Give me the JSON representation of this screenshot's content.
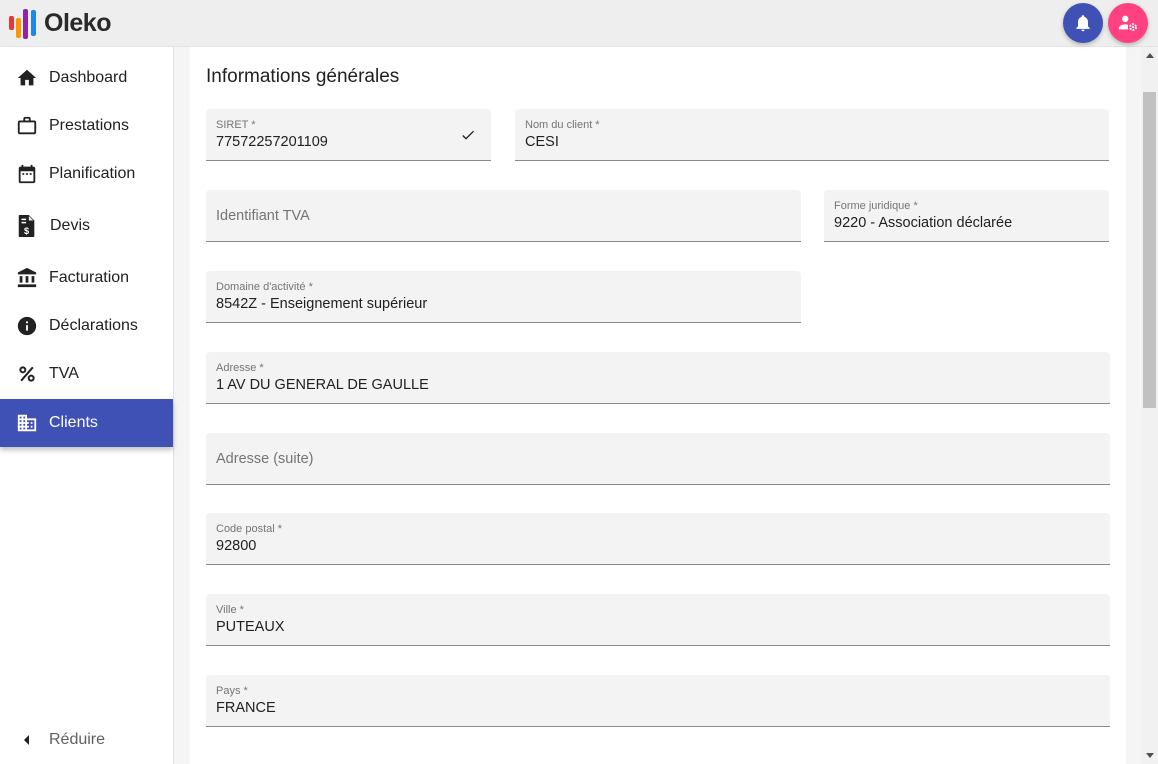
{
  "app": {
    "name": "Oleko",
    "logo_colors": [
      "#e53935",
      "#ff9800",
      "#8e24aa",
      "#1e88e5"
    ]
  },
  "header": {
    "notifications_icon": "bell-icon",
    "account_icon": "user-settings-icon",
    "notifications_color": "#3f51b5",
    "account_color": "#ff4081"
  },
  "sidebar": {
    "items": [
      {
        "label": "Dashboard",
        "icon": "home-icon",
        "active": false
      },
      {
        "label": "Prestations",
        "icon": "briefcase-icon",
        "active": false
      },
      {
        "label": "Planification",
        "icon": "calendar-icon",
        "active": false
      },
      {
        "label": "Devis",
        "icon": "invoice-dollar-icon",
        "active": false
      },
      {
        "label": "Facturation",
        "icon": "bank-icon",
        "active": false
      },
      {
        "label": "Déclarations",
        "icon": "info-icon",
        "active": false
      },
      {
        "label": "TVA",
        "icon": "percent-icon",
        "active": false
      },
      {
        "label": "Clients",
        "icon": "building-icon",
        "active": true
      }
    ],
    "collapse_label": "Réduire",
    "active_color": "#3f51b5"
  },
  "form": {
    "title": "Informations générales",
    "fields": {
      "siret": {
        "label": "SIRET *",
        "value": "77572257201109",
        "validated": true
      },
      "nom_client": {
        "label": "Nom du client *",
        "value": "CESI"
      },
      "identifiant_tva": {
        "placeholder": "Identifiant TVA",
        "value": ""
      },
      "forme_juridique": {
        "label": "Forme juridique *",
        "value": "9220 - Association déclarée"
      },
      "domaine_activite": {
        "label": "Domaine d'activité *",
        "value": "8542Z - Enseignement supérieur"
      },
      "adresse": {
        "label": "Adresse *",
        "value": "1 AV DU GENERAL DE GAULLE"
      },
      "adresse_suite": {
        "placeholder": "Adresse (suite)",
        "value": ""
      },
      "code_postal": {
        "label": "Code postal *",
        "value": "92800"
      },
      "ville": {
        "label": "Ville *",
        "value": "PUTEAUX"
      },
      "pays": {
        "label": "Pays *",
        "value": "FRANCE"
      }
    }
  }
}
